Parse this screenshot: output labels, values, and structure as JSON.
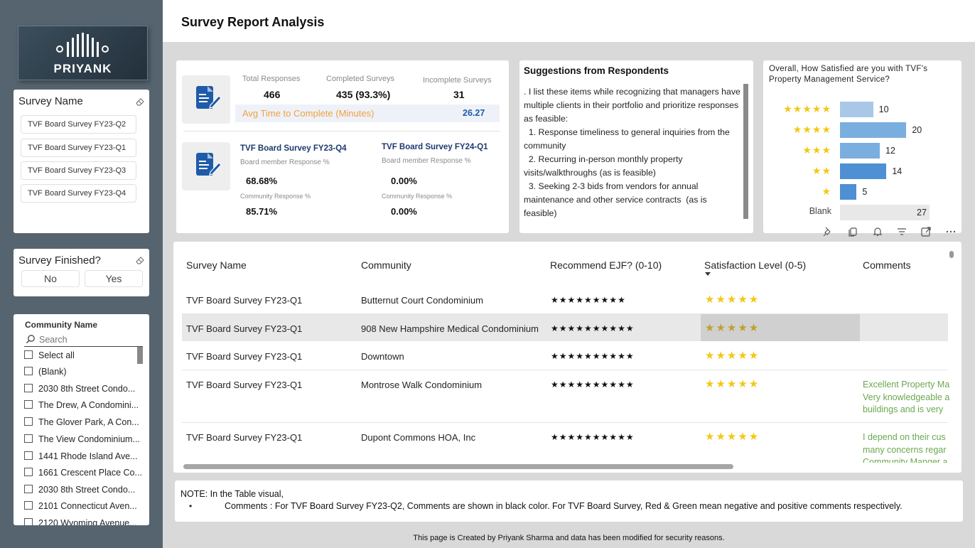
{
  "logo": {
    "text": "PRIYANK"
  },
  "header": {
    "title": "Survey Report Analysis"
  },
  "survey_name_slicer": {
    "title": "Survey Name",
    "items": [
      "TVF Board Survey FY23-Q2",
      "TVF Board Survey FY23-Q1",
      "TVF Board Survey FY23-Q3",
      "TVF Board Survey FY23-Q4"
    ]
  },
  "survey_finished_slicer": {
    "title": "Survey Finished?",
    "options": [
      "No",
      "Yes"
    ]
  },
  "community_slicer": {
    "title": "Community Name",
    "search_placeholder": "Search",
    "items": [
      "Select all",
      "(Blank)",
      "2030 8th Street Condo...",
      "The Drew, A Condomini...",
      "The Glover Park, A Con...",
      "The View Condominium...",
      "1441 Rhode Island Ave...",
      "1661 Crescent Place Co...",
      "2030 8th Street Condo...",
      "2101 Connecticut Aven...",
      "2120 Wyoming Avenue..."
    ]
  },
  "kpis": {
    "total_label": "Total Responses",
    "total_value": "466",
    "completed_label": "Completed Surveys",
    "completed_value": "435 (93.3%)",
    "incomplete_label": "Incomplete Surveys",
    "incomplete_value": "31",
    "avg_label": "Avg Time to Complete (Minutes)",
    "avg_value": "26.27"
  },
  "board_q4": {
    "title": "TVF Board Survey FY23-Q4",
    "board_label": "Board member Response %",
    "board_value": "68.68%",
    "community_label": "Community Response %",
    "community_value": "85.71%"
  },
  "board_fy24": {
    "title": "TVF Board Survey FY24-Q1",
    "board_label": "Board member Response %",
    "board_value": "0.00%",
    "community_label": "Community Response %",
    "community_value": "0.00%"
  },
  "suggestions": {
    "title": "Suggestions from Respondents",
    "lines": [
      ". I list these items while recognizing that managers have multiple clients in their portfolio and prioritize responses as feasible:",
      "  1. Response timeliness to general inquiries from the community",
      "  2. Recurring in-person monthly property visits/walkthroughs (as is feasible)",
      "  3. Seeking 2-3 bids from vendors for annual maintenance and other service contracts  (as is feasible)"
    ]
  },
  "satisfaction_chart": {
    "title": "Overall, How Satisfied are you with TVF's Property Management Service?"
  },
  "chart_data": {
    "type": "bar",
    "title": "Overall, How Satisfied are you with TVF's Property Management Service?",
    "categories": [
      "★★★★★",
      "★★★★",
      "★★★",
      "★★",
      "★",
      "Blank"
    ],
    "values": [
      10,
      20,
      12,
      14,
      5,
      27
    ],
    "colors": [
      "#a9c8e8",
      "#7aaedf",
      "#7aaedf",
      "#4f8fd3",
      "#4f8fd3",
      "#e8e8e8"
    ],
    "xlim": [
      0,
      27
    ]
  },
  "table": {
    "headers": [
      "Survey Name",
      "Community",
      "Recommend EJF? (0-10)",
      "Satisfaction Level (0-5)",
      "Comments"
    ],
    "rows": [
      {
        "survey": "TVF Board Survey FY23-Q1",
        "community": "Butternut Court Condominium",
        "recommend": 9,
        "satisfaction": 5,
        "comment": []
      },
      {
        "survey": "TVF Board Survey FY23-Q1",
        "community": "908 New Hampshire Medical Condominium",
        "recommend": 10,
        "satisfaction": 5,
        "comment": []
      },
      {
        "survey": "TVF Board Survey FY23-Q1",
        "community": "Downtown",
        "recommend": 10,
        "satisfaction": 5,
        "comment": []
      },
      {
        "survey": "TVF Board Survey FY23-Q1",
        "community": "Montrose Walk Condominium",
        "recommend": 10,
        "satisfaction": 5,
        "comment": [
          "Excellent Property Ma",
          "Very knowledgeable a",
          "buildings and is very"
        ]
      },
      {
        "survey": "TVF Board Survey FY23-Q1",
        "community": "Dupont Commons HOA, Inc",
        "recommend": 10,
        "satisfaction": 5,
        "comment": [
          "I depend on their cus",
          "many concerns regar",
          "Community Manger a"
        ]
      }
    ]
  },
  "note": {
    "title": "NOTE:  In the Table visual,",
    "bullet": "Comments : For TVF Board Survey FY23-Q2, Comments are shown in black color. For TVF Board Survey, Red & Green mean negative and positive comments respectively."
  },
  "footer": {
    "text": "This page is Created by Priyank Sharma and data has been modified for security reasons."
  },
  "colors": {
    "sidebar": "#566470",
    "accent_orange": "#f0a040",
    "accent_blue": "#1e5ba8",
    "star": "#f2c811",
    "positive": "#6aa84f"
  }
}
